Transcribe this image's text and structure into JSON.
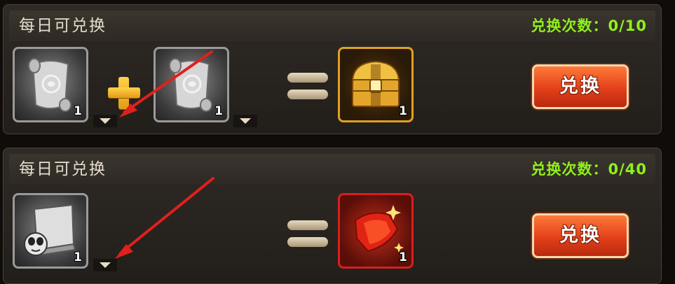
{
  "rows": [
    {
      "title": "每日可兑换",
      "count": "兑换次数：0/10",
      "inputs": [
        {
          "icon": "scroll-icon",
          "qty": "1"
        },
        {
          "icon": "scroll-icon",
          "qty": "1"
        }
      ],
      "operator": "plus-icon",
      "result": {
        "icon": "treasure-chest-icon",
        "qty": "1"
      },
      "button_label": "兑换"
    },
    {
      "title": "每日可兑换",
      "count": "兑换次数：0/40",
      "inputs": [
        {
          "icon": "skill-book-icon",
          "qty": "1"
        }
      ],
      "result": {
        "icon": "red-fragment-icon",
        "qty": "1"
      },
      "button_label": "兑换"
    }
  ],
  "colors": {
    "count_green": "#8ff01a",
    "button_orange": "#e2401a",
    "annotation_red": "#e0201c"
  }
}
